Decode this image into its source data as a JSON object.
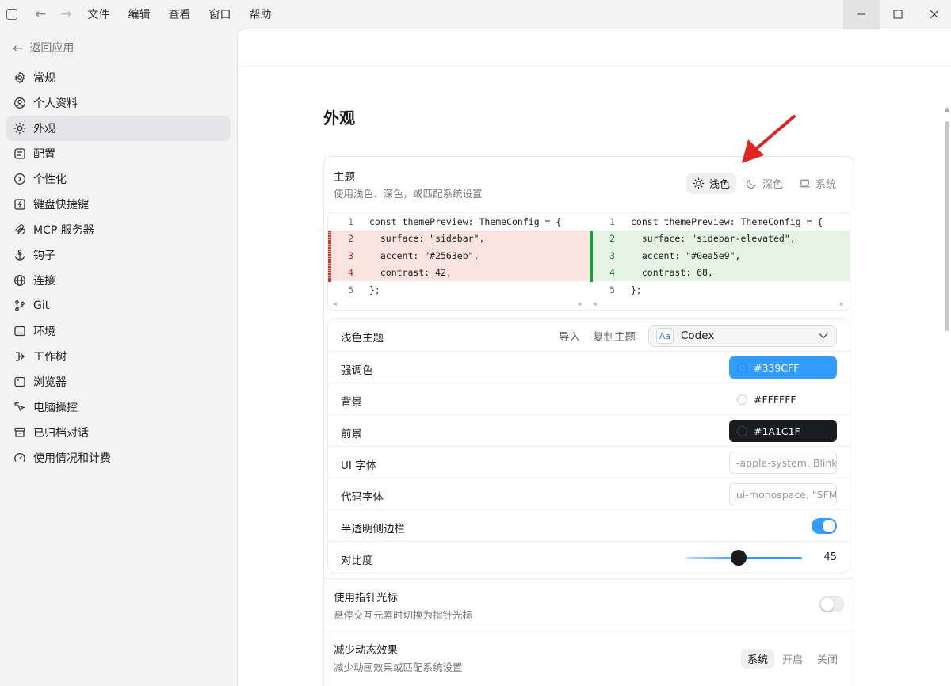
{
  "menu": {
    "items": [
      "文件",
      "编辑",
      "查看",
      "窗口",
      "帮助"
    ]
  },
  "sidebar": {
    "back_label": "返回应用",
    "items": [
      {
        "label": "常规",
        "icon": "gear-icon"
      },
      {
        "label": "个人资料",
        "icon": "profile-icon"
      },
      {
        "label": "外观",
        "icon": "sun-icon"
      },
      {
        "label": "配置",
        "icon": "config-icon"
      },
      {
        "label": "个性化",
        "icon": "personalize-icon"
      },
      {
        "label": "键盘快捷键",
        "icon": "keyboard-icon"
      },
      {
        "label": "MCP 服务器",
        "icon": "mcp-icon"
      },
      {
        "label": "钩子",
        "icon": "anchor-icon"
      },
      {
        "label": "连接",
        "icon": "globe-icon"
      },
      {
        "label": "Git",
        "icon": "git-branch-icon"
      },
      {
        "label": "环境",
        "icon": "terminal-icon"
      },
      {
        "label": "工作树",
        "icon": "worktree-icon"
      },
      {
        "label": "浏览器",
        "icon": "browser-icon"
      },
      {
        "label": "电脑操控",
        "icon": "computer-control-icon"
      },
      {
        "label": "已归档对话",
        "icon": "archive-icon"
      },
      {
        "label": "使用情况和计费",
        "icon": "gauge-icon"
      }
    ],
    "active_index": 2
  },
  "page": {
    "title": "外观"
  },
  "theme": {
    "label": "主题",
    "description": "使用浅色、深色，或匹配系统设置",
    "options": [
      "浅色",
      "深色",
      "系统"
    ],
    "selected": "浅色"
  },
  "diff": {
    "left": [
      {
        "n": "1",
        "text": "const themePreview: ThemeConfig = {"
      },
      {
        "n": "2",
        "text": "  surface: \"sidebar\","
      },
      {
        "n": "3",
        "text": "  accent: \"#2563eb\","
      },
      {
        "n": "4",
        "text": "  contrast: 42,"
      },
      {
        "n": "5",
        "text": "};"
      }
    ],
    "right": [
      {
        "n": "1",
        "text": "const themePreview: ThemeConfig = {"
      },
      {
        "n": "2",
        "text": "  surface: \"sidebar-elevated\","
      },
      {
        "n": "3",
        "text": "  accent: \"#0ea5e9\","
      },
      {
        "n": "4",
        "text": "  contrast: 68,"
      },
      {
        "n": "5",
        "text": "};"
      }
    ]
  },
  "light_theme": {
    "label": "浅色主题",
    "import_label": "导入",
    "copy_label": "复制主题",
    "preset_badge": "Aa",
    "preset_value": "Codex",
    "accent_label": "强调色",
    "accent_value": "#339CFF",
    "background_label": "背景",
    "background_value": "#FFFFFF",
    "foreground_label": "前景",
    "foreground_value": "#1A1C1F",
    "ui_font_label": "UI 字体",
    "ui_font_value": "-apple-system, BlinkMacSystemFont",
    "code_font_label": "代码字体",
    "code_font_value": "ui-monospace, \"SFMono-Regular\"",
    "translucent_label": "半透明侧边栏",
    "translucent_on": true,
    "contrast_label": "对比度",
    "contrast_value": "45"
  },
  "pointer": {
    "label": "使用指针光标",
    "description": "悬停交互元素时切换为指针光标",
    "on": false
  },
  "motion": {
    "label": "减少动态效果",
    "description": "减少动画效果或匹配系统设置",
    "options": [
      "系统",
      "开启",
      "关闭"
    ],
    "selected": "系统"
  },
  "colors": {
    "accent": "#339CFF",
    "arrow": "#e02424"
  }
}
